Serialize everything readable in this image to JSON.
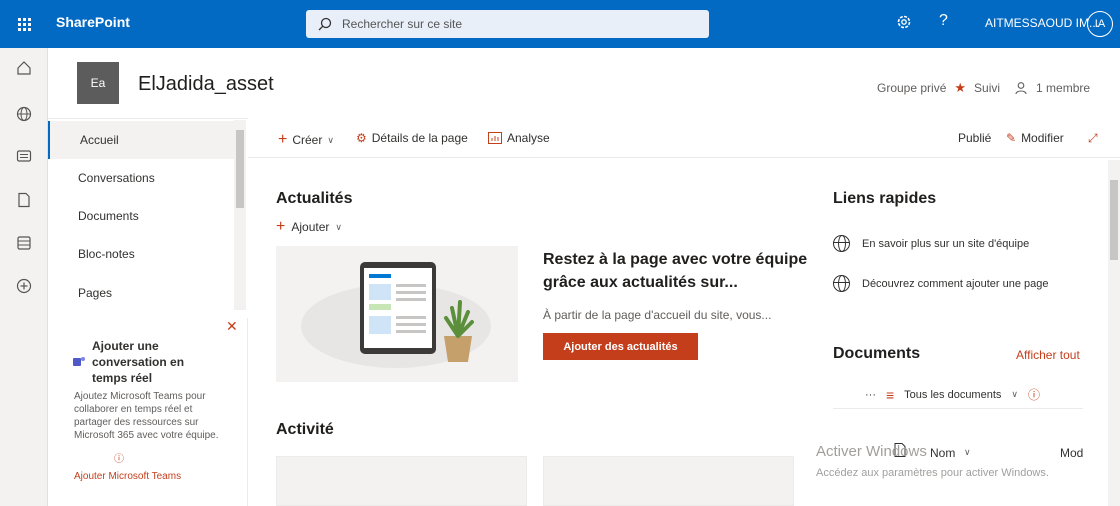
{
  "suite": {
    "app_name": "SharePoint",
    "search_placeholder": "Rechercher sur ce site",
    "help": "?",
    "user_name": "AITMESSAOUD IM...",
    "user_initials": "IA"
  },
  "site": {
    "logo_initials": "Ea",
    "title": "ElJadida_asset",
    "privacy": "Groupe privé",
    "follow": "Suivi",
    "members": "1 membre"
  },
  "nav": {
    "items": [
      {
        "label": "Accueil"
      },
      {
        "label": "Conversations"
      },
      {
        "label": "Documents"
      },
      {
        "label": "Bloc-notes"
      },
      {
        "label": "Pages"
      }
    ]
  },
  "teams_promo": {
    "title": "Ajouter une conversation en temps réel",
    "description": "Ajoutez Microsoft Teams pour collaborer en temps réel et partager des ressources sur Microsoft 365 avec votre équipe.",
    "link": "Ajouter Microsoft Teams"
  },
  "commandbar": {
    "create": "Créer",
    "page_details": "Détails de la page",
    "analytics": "Analyse",
    "status": "Publié",
    "edit": "Modifier"
  },
  "news": {
    "heading": "Actualités",
    "add": "Ajouter",
    "title": "Restez à la page avec votre équipe grâce aux actualités sur...",
    "description": "À partir de la page d'accueil du site, vous...",
    "button": "Ajouter des actualités"
  },
  "activity": {
    "heading": "Activité"
  },
  "quick_links": {
    "heading": "Liens rapides",
    "items": [
      {
        "label": "En savoir plus sur un site d'équipe"
      },
      {
        "label": "Découvrez comment ajouter une page"
      }
    ]
  },
  "documents": {
    "heading": "Documents",
    "show_all": "Afficher tout",
    "more": "···",
    "view": "Tous les documents",
    "col_name": "Nom",
    "col_modified": "Mod"
  },
  "watermark": {
    "line1": "Activer Windows",
    "line2": "Accédez aux paramètres pour activer Windows."
  },
  "colors": {
    "suite_blue": "#036ac4",
    "accent_orange": "#c43e1c"
  }
}
